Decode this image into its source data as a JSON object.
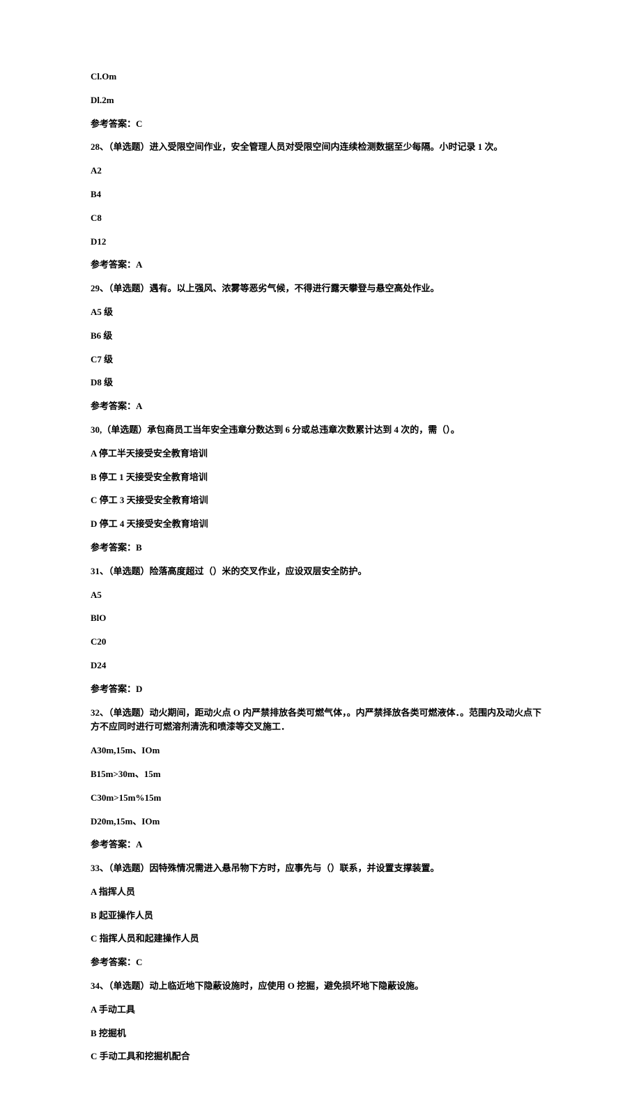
{
  "lines": [
    "Cl.Om",
    "Dl.2m",
    "参考答案：C",
    "28、（单选题）进入受限空间作业，安全管理人员对受限空间内连续检测数据至少每隔。小时记录 1 次。",
    "A2",
    "B4",
    "C8",
    "D12",
    "参考答案：A",
    "29、（单选题）遇有。以上强风、浓雾等恶劣气候，不得进行露天攀登与悬空高处作业。",
    "A5 级",
    "B6 级",
    "C7 级",
    "D8 级",
    "参考答案：A",
    "30,（单选题）承包商员工当年安全违章分数达到 6 分或总违章次数累计达到 4 次的，需（）。",
    "A 停工半天接受安全教育培训",
    "B 停工 1 天接受安全教育培训",
    "C 停工 3 天接受安全教育培训",
    "D 停工 4 天接受安全教育培训",
    "参考答案：B",
    "31、（单选题）险落高度超过（）米的交叉作业，应设双层安全防护。",
    "A5",
    "BlO",
    "C20",
    "D24",
    "参考答案：D",
    "32、（单选题）动火期间，距动火点 O 内严禁排放各类可燃气体，。内严禁择放各类可燃液体．。范围内及动火点下方不应同时进行可燃溶剂清洗和喷漆等交叉施工．",
    "A30m,15m、IOm",
    "B15m>30m、15m",
    "C30m>15m%15m",
    "D20m,15m、IOm",
    "参考答案：A",
    "33、（单选题）因特殊情况需进入悬吊物下方时，应事先与（）联系，并设置支撑装置。",
    "A 指挥人员",
    "B 起亚操作人员",
    "C 指挥人员和起建操作人员",
    "参考答案：C",
    "34、（单选题）动上临近地下隐蔽设施时，应使用 O 挖掘，避免损坏地下隐蔽设施。",
    "A 手动工具",
    "B 挖掘机",
    "C 手动工具和挖掘机配合"
  ]
}
